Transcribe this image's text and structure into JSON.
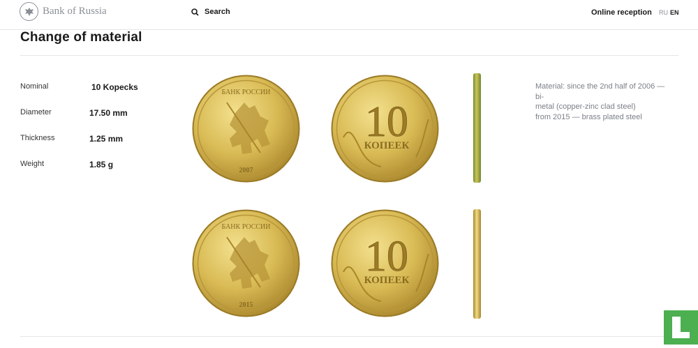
{
  "header": {
    "logo_text": "Bank of Russia",
    "search_label": "Search",
    "reception_label": "Online reception",
    "lang_ru": "RU",
    "lang_en": "EN"
  },
  "page": {
    "title": "Change of material"
  },
  "specs": [
    {
      "label": "Nominal",
      "value": "10 Kopecks"
    },
    {
      "label": "Diameter",
      "value": "17.50 mm"
    },
    {
      "label": "Thickness",
      "value": "1.25 mm"
    },
    {
      "label": "Weight",
      "value": "1.85 g"
    }
  ],
  "coins": {
    "obverse_text": "БАНК РОССИИ",
    "year_2007": "2007",
    "year_2015": "2015",
    "denomination": "10",
    "denomination_word": "КОПЕЕК"
  },
  "material_text": {
    "line1": "Material: since the 2nd half of 2006 — bi-",
    "line2": "metal (copper-zinc clad steel)",
    "line3": "from 2015 — brass plated steel"
  },
  "colors": {
    "gold_light": "#e9d27a",
    "gold_mid": "#cfb04a",
    "gold_dark": "#a8852a",
    "edge_green": "#7f9a3a",
    "corner_green": "#4caf50"
  }
}
